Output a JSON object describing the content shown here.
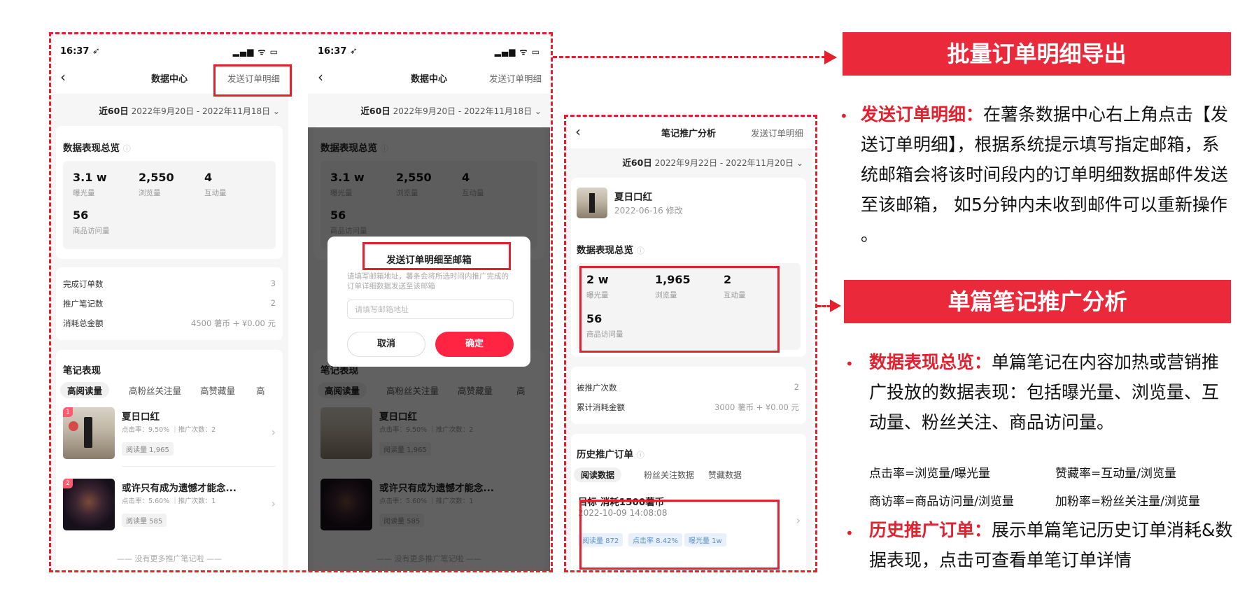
{
  "screen1": {
    "time": "16:37 ➶",
    "status_icons": "▂▄▆ ᯤ ▭",
    "back": "‹",
    "title": "数据中心",
    "right_link": "发送订单明细",
    "date_bold": "近60日",
    "date_range": "2022年9月20日 - 2022年11月18日 ⌄",
    "overview_title": "数据表现总览",
    "info": "ⓘ",
    "metrics": [
      {
        "value": "3.1 w",
        "label": "曝光量"
      },
      {
        "value": "2,550",
        "label": "浏览量"
      },
      {
        "value": "4",
        "label": "互动量"
      },
      {
        "value": "56",
        "label": "商品访问量"
      }
    ],
    "rows": [
      {
        "label": "完成订单数",
        "value": "3"
      },
      {
        "label": "推广笔记数",
        "value": "2"
      },
      {
        "label": "消耗总金额",
        "value": "4500 薯币 + ¥0.00 元"
      }
    ],
    "notes_title": "笔记表现",
    "tabs": [
      "高阅读量",
      "高粉丝关注量",
      "高赞藏量",
      "高"
    ],
    "notes": [
      {
        "rank": "1",
        "title": "夏日口红",
        "sub": "点击率：9.50% ｜推广次数：2",
        "chip": "阅读量 1,965"
      },
      {
        "rank": "2",
        "title": "或许只有成为遗憾才能念...",
        "sub": "点击率：5.60% ｜推广次数：1",
        "chip": "阅读量 585"
      }
    ],
    "footer": "—— 没有更多推广笔记啦 ——"
  },
  "screen2": {
    "modal_title": "发送订单明细至邮箱",
    "modal_desc": "请填写邮箱地址，薯条会将所选时间内推广完成的订单详细数据发送至该邮箱",
    "input_placeholder": "请填写邮箱地址",
    "cancel": "取消",
    "confirm": "确定"
  },
  "screen3": {
    "back": "‹",
    "title": "笔记推广分析",
    "right_link": "发送订单明细",
    "date_bold": "近60日",
    "date_range": "2022年9月22日 - 2022年11月20日 ⌄",
    "note_title": "夏日口红",
    "note_date": "2022-06-16 修改",
    "overview_title": "数据表现总览",
    "info": "ⓘ",
    "metrics": [
      {
        "value": "2 w",
        "label": "曝光量"
      },
      {
        "value": "1,965",
        "label": "浏览量"
      },
      {
        "value": "2",
        "label": "互动量"
      },
      {
        "value": "56",
        "label": "商品访问量"
      }
    ],
    "rows": [
      {
        "label": "被推广次数",
        "value": "2"
      },
      {
        "label": "累计消耗金额",
        "value": "3000 薯币 + ¥0.00 元"
      }
    ],
    "history_title": "历史推广订单",
    "tabs": [
      "阅读数据",
      "粉丝关注数据",
      "赞藏数据"
    ],
    "order_title": "目标   消耗1500薯币",
    "order_time": "2022-10-09 14:08:08",
    "order_tags": [
      "阅读量 872",
      "点击率 8.42%",
      "曝光量 1w"
    ]
  },
  "panel": {
    "banner1": "批量订单明细导出",
    "banner2": "单篇笔记推广分析",
    "bullet": "•",
    "p1_em": "发送订单明细：",
    "p1_text": "在薯条数据中心右上角点击【发送订单明细】，根据系统提示填写指定邮箱，系统邮箱会将该时间段内的订单明细数据邮件发送至该邮箱， 如5分钟内未收到邮件可以重新操作 。",
    "p2_em": "数据表现总览：",
    "p2_text": "单篇笔记在内容加热或营销推广投放的数据表现：包括曝光量、浏览量、互动量、粉丝关注、商品访问量。",
    "formulas": [
      "点击率=浏览量/曝光量",
      "赞藏率=互动量/浏览量",
      "商访率=商品访问量/浏览量",
      "加粉率=粉丝关注量/浏览量"
    ],
    "p3_em": "历史推广订单：",
    "p3_text": "展示单篇笔记历史订单消耗&数据表现，点击可查看单笔订单详情"
  },
  "colors": {
    "accent_red": "#e5202e",
    "brand_red": "#ff2442",
    "banner_red": "#ea2a3a"
  }
}
